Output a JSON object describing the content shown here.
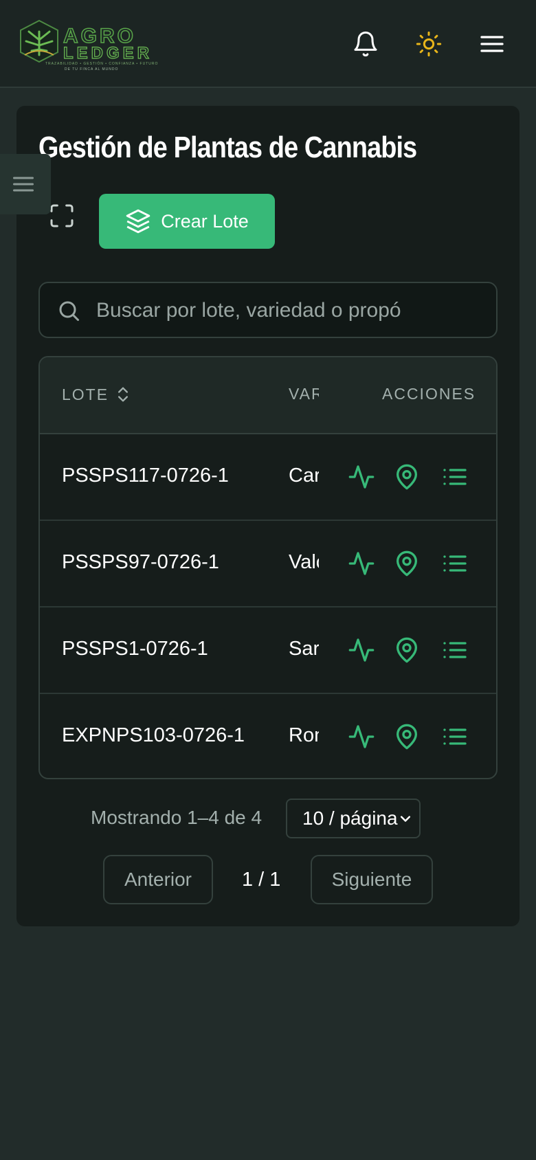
{
  "brand": {
    "word1": "AGRO",
    "word2": "LEDGER",
    "tagline": "TRAZABILIDAD • GESTIÓN • CONFIANZA • FUTURO",
    "slogan": "DE TU FINCA AL MUNDO"
  },
  "header": {
    "icons": [
      "bell-icon",
      "sun-icon",
      "menu-icon"
    ],
    "accent": "#e8b51a"
  },
  "page": {
    "title": "Gestión de Plantas de Cannabis",
    "create_label": "Crear Lote",
    "accent": "#37b978"
  },
  "search": {
    "placeholder": "Buscar por lote, variedad o propó"
  },
  "table": {
    "columns": [
      "LOTE",
      "VAR",
      "ACCIONES"
    ],
    "rows": [
      {
        "lote": "PSSPS117-0726-1",
        "variedad": "Car"
      },
      {
        "lote": "PSSPS97-0726-1",
        "variedad": "Valo"
      },
      {
        "lote": "PSSPS1-0726-1",
        "variedad": "Sar"
      },
      {
        "lote": "EXPNPS103-0726-1",
        "variedad": "Ron"
      }
    ],
    "row_actions": [
      "activity-icon",
      "map-pin-icon",
      "list-icon"
    ]
  },
  "pagination": {
    "info": "Mostrando 1–4 de 4",
    "page_size": "10 / página",
    "prev": "Anterior",
    "page": "1 / 1",
    "next": "Siguiente"
  }
}
